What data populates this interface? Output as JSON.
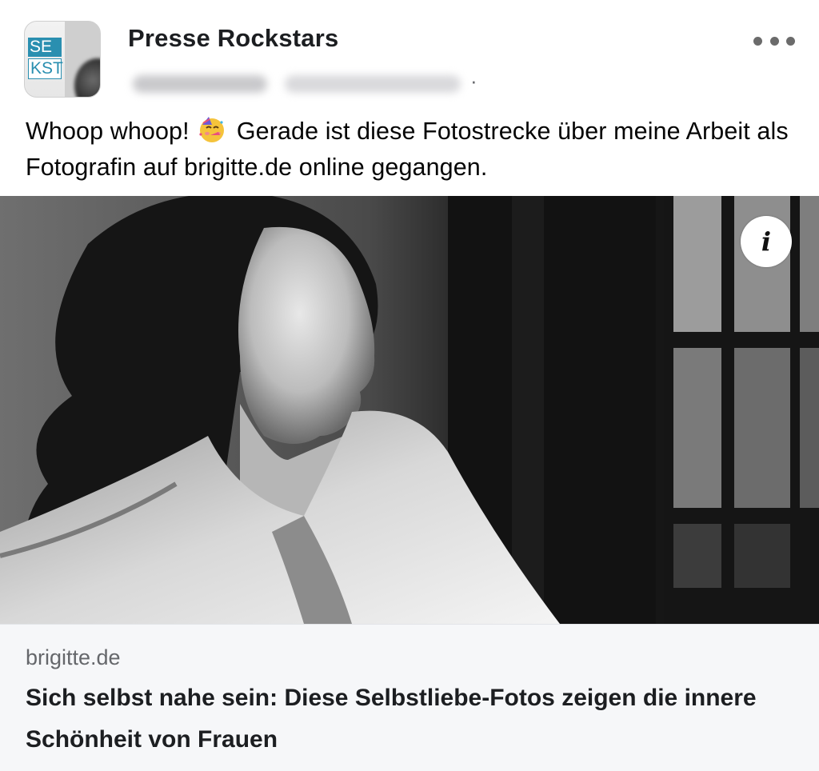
{
  "post": {
    "group_name": "Presse Rockstars",
    "group_logo_lines": [
      "SE",
      "KST"
    ],
    "text_before_emoji": "Whoop whoop! ",
    "emoji_icon": "partying-face-emoji",
    "text_after_emoji": " Gerade ist diese Fotostrecke über meine Arbeit als Fotografin auf brigitte.de online gegangen.",
    "more_icon": "more-horizontal-icon"
  },
  "media": {
    "info_label": "i",
    "info_icon": "info-icon"
  },
  "link_preview": {
    "domain": "brigitte.de",
    "title": "Sich selbst nahe sein: Diese Selbstliebe-Fotos zeigen die innere Schönheit von Frauen"
  },
  "colors": {
    "text_primary": "#050505",
    "text_secondary": "#65676b",
    "card_background": "#f6f7f9",
    "logo_accent": "#2a8fb0"
  }
}
